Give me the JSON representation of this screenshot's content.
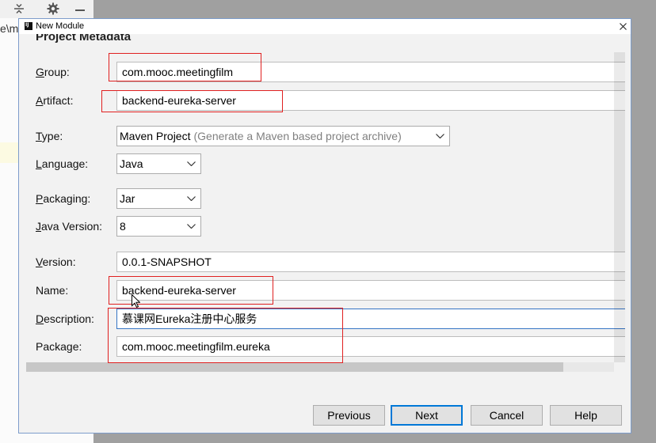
{
  "ide": {
    "path_fragment": "e\\m",
    "toolbar_icons": [
      "collapse-all-icon",
      "gear-icon",
      "minimize-icon"
    ]
  },
  "dialog": {
    "title": "New Module",
    "logo_text": "IJ",
    "icons": {
      "app": "intellij-logo-icon",
      "close": "close-icon",
      "dropdown": "chevron-down-icon",
      "pointer": "mouse-cursor-icon"
    },
    "section_title": "Project Metadata",
    "form": {
      "group": {
        "label": "Group:",
        "value": "com.mooc.meetingfilm"
      },
      "artifact": {
        "label": "Artifact:",
        "value": "backend-eureka-server"
      },
      "type": {
        "label": "Type:",
        "selected": "Maven Project",
        "hint": "(Generate a Maven based project archive)"
      },
      "language": {
        "label": "Language:",
        "selected": "Java"
      },
      "packaging": {
        "label": "Packaging:",
        "selected": "Jar"
      },
      "java_version": {
        "label": "Java Version:",
        "selected": "8"
      },
      "version": {
        "label": "Version:",
        "value": "0.0.1-SNAPSHOT"
      },
      "name": {
        "label": "Name:",
        "value": "backend-eureka-server"
      },
      "description": {
        "label": "Description:",
        "value": "慕课网Eureka注册中心服务",
        "focused": true
      },
      "package": {
        "label": "Package:",
        "value": "com.mooc.meetingfilm.eureka"
      }
    },
    "buttons": {
      "previous": "Previous",
      "next": "Next",
      "cancel": "Cancel",
      "help": "Help",
      "next_is_default": true
    }
  },
  "colors": {
    "backdrop": "#a0a0a0",
    "annotation_red": "#e02020",
    "focus_border": "#3574c4",
    "default_button_border": "#0078d7",
    "hint_text": "#808080"
  }
}
